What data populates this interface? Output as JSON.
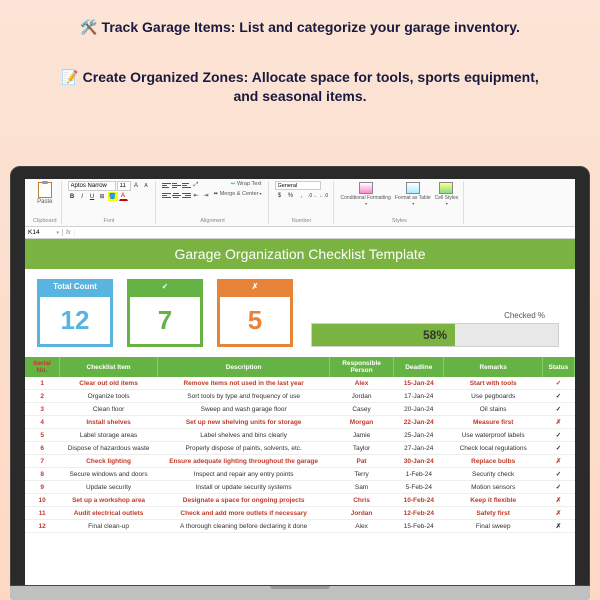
{
  "promo": {
    "line1_icon": "🛠️",
    "line1": "Track Garage Items: List and categorize your garage inventory.",
    "line2_icon": "📝",
    "line2": "Create Organized Zones: Allocate space for tools, sports equipment, and seasonal items."
  },
  "ribbon": {
    "paste_label": "Paste",
    "clipboard_label": "Clipboard",
    "font_name": "Aptos Narrow",
    "font_size": "11",
    "font_label": "Font",
    "wrap_text": "Wrap Text",
    "merge_center": "Merge & Center",
    "alignment_label": "Alignment",
    "number_format": "General",
    "number_label": "Number",
    "cond_fmt": "Conditional Formatting",
    "fmt_table": "Format as Table",
    "cell_styles": "Cell Styles",
    "styles_label": "Styles"
  },
  "formula_bar": {
    "name_box": "K14",
    "fx": "fx"
  },
  "sheet": {
    "title": "Garage Organization Checklist Template",
    "cards": {
      "total_label": "Total Count",
      "total_value": "12",
      "check_label": "✓",
      "check_value": "7",
      "x_label": "✗",
      "x_value": "5",
      "progress_label": "Checked %",
      "progress_value": "58%",
      "progress_pct": 58
    },
    "columns": [
      "Serial No.",
      "Checklist Item",
      "Description",
      "Responsible Person",
      "Deadline",
      "Remarks",
      "Status"
    ],
    "rows": [
      {
        "n": "1",
        "item": "Clear out old items",
        "desc": "Remove items not used in the last year",
        "person": "Alex",
        "deadline": "15-Jan-24",
        "remarks": "Start with tools",
        "status": "✓",
        "red": true
      },
      {
        "n": "2",
        "item": "Organize tools",
        "desc": "Sort tools by type and frequency of use",
        "person": "Jordan",
        "deadline": "17-Jan-24",
        "remarks": "Use pegboards",
        "status": "✓",
        "red": false
      },
      {
        "n": "3",
        "item": "Clean floor",
        "desc": "Sweep and wash garage floor",
        "person": "Casey",
        "deadline": "20-Jan-24",
        "remarks": "Oil stains",
        "status": "✓",
        "red": false
      },
      {
        "n": "4",
        "item": "Install shelves",
        "desc": "Set up new shelving units for storage",
        "person": "Morgan",
        "deadline": "22-Jan-24",
        "remarks": "Measure first",
        "status": "✗",
        "red": true
      },
      {
        "n": "5",
        "item": "Label storage areas",
        "desc": "Label shelves and bins clearly",
        "person": "Jamie",
        "deadline": "25-Jan-24",
        "remarks": "Use waterproof labels",
        "status": "✓",
        "red": false
      },
      {
        "n": "6",
        "item": "Dispose of hazardous waste",
        "desc": "Properly dispose of paints, solvents, etc.",
        "person": "Taylor",
        "deadline": "27-Jan-24",
        "remarks": "Check local regulations",
        "status": "✓",
        "red": false
      },
      {
        "n": "7",
        "item": "Check lighting",
        "desc": "Ensure adequate lighting throughout the garage",
        "person": "Pat",
        "deadline": "30-Jan-24",
        "remarks": "Replace bulbs",
        "status": "✗",
        "red": true
      },
      {
        "n": "8",
        "item": "Secure windows and doors",
        "desc": "Inspect and repair any entry points",
        "person": "Terry",
        "deadline": "1-Feb-24",
        "remarks": "Security check",
        "status": "✓",
        "red": false
      },
      {
        "n": "9",
        "item": "Update security",
        "desc": "Install or update security systems",
        "person": "Sam",
        "deadline": "5-Feb-24",
        "remarks": "Motion sensors",
        "status": "✓",
        "red": false
      },
      {
        "n": "10",
        "item": "Set up a workshop area",
        "desc": "Designate a space for ongoing projects",
        "person": "Chris",
        "deadline": "10-Feb-24",
        "remarks": "Keep it flexible",
        "status": "✗",
        "red": true
      },
      {
        "n": "11",
        "item": "Audit electrical outlets",
        "desc": "Check and add more outlets if necessary",
        "person": "Jordan",
        "deadline": "12-Feb-24",
        "remarks": "Safety first",
        "status": "✗",
        "red": true
      },
      {
        "n": "12",
        "item": "Final clean-up",
        "desc": "A thorough cleaning before declaring it done",
        "person": "Alex",
        "deadline": "15-Feb-24",
        "remarks": "Final sweep",
        "status": "✗",
        "red": false
      }
    ]
  }
}
